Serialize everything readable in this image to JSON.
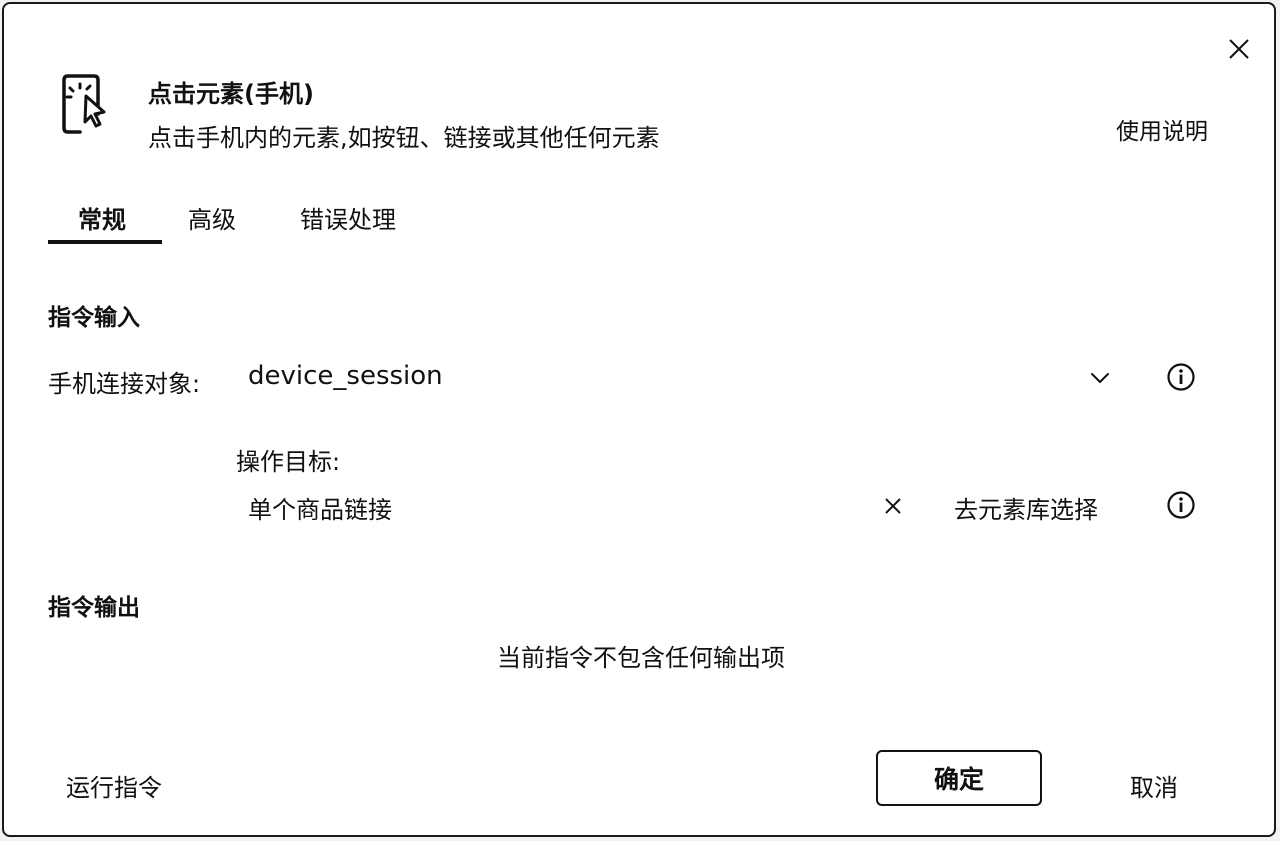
{
  "header": {
    "icon": "tap-phone-icon",
    "title": "点击元素(手机)",
    "subtitle": "点击手机内的元素,如按钮、链接或其他任何元素",
    "help_link": "使用说明"
  },
  "tabs": [
    {
      "label": "常规",
      "active": true
    },
    {
      "label": "高级",
      "active": false
    },
    {
      "label": "错误处理",
      "active": false
    }
  ],
  "input_section": {
    "title": "指令输入",
    "connection": {
      "label": "手机连接对象:",
      "value": "device_session"
    },
    "target": {
      "label": "操作目标:",
      "value": "单个商品链接",
      "library_link": "去元素库选择"
    }
  },
  "output_section": {
    "title": "指令输出",
    "empty_text": "当前指令不包含任何输出项"
  },
  "footer": {
    "run_label": "运行指令",
    "confirm_label": "确定",
    "cancel_label": "取消"
  }
}
